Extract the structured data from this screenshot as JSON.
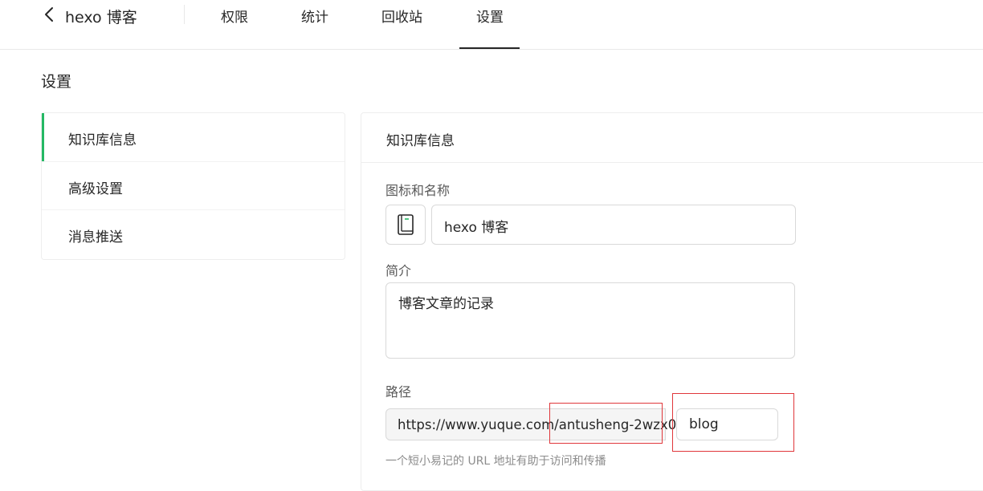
{
  "header": {
    "book_title": "hexo 博客",
    "tabs": [
      {
        "label": "权限"
      },
      {
        "label": "统计"
      },
      {
        "label": "回收站"
      },
      {
        "label": "设置",
        "active": true
      }
    ]
  },
  "page": {
    "title": "设置"
  },
  "sidebar": {
    "items": [
      {
        "label": "知识库信息",
        "active": true
      },
      {
        "label": "高级设置"
      },
      {
        "label": "消息推送"
      }
    ]
  },
  "card": {
    "title": "知识库信息",
    "name_field": {
      "label": "图标和名称",
      "icon": "book-icon",
      "value": "hexo 博客"
    },
    "description_field": {
      "label": "简介",
      "value": "博客文章的记录"
    },
    "path_field": {
      "label": "路径",
      "prefix": "https://www.yuque.com/antusheng-2wzx0/",
      "value": "blog",
      "hint": "一个短小易记的 URL 地址有助于访问和传播"
    }
  },
  "colors": {
    "accent_green": "#25b864",
    "annotation_red": "#e0373b",
    "text": "#262626",
    "muted_text": "#8c8c8c",
    "border": "#d9d9d9"
  }
}
